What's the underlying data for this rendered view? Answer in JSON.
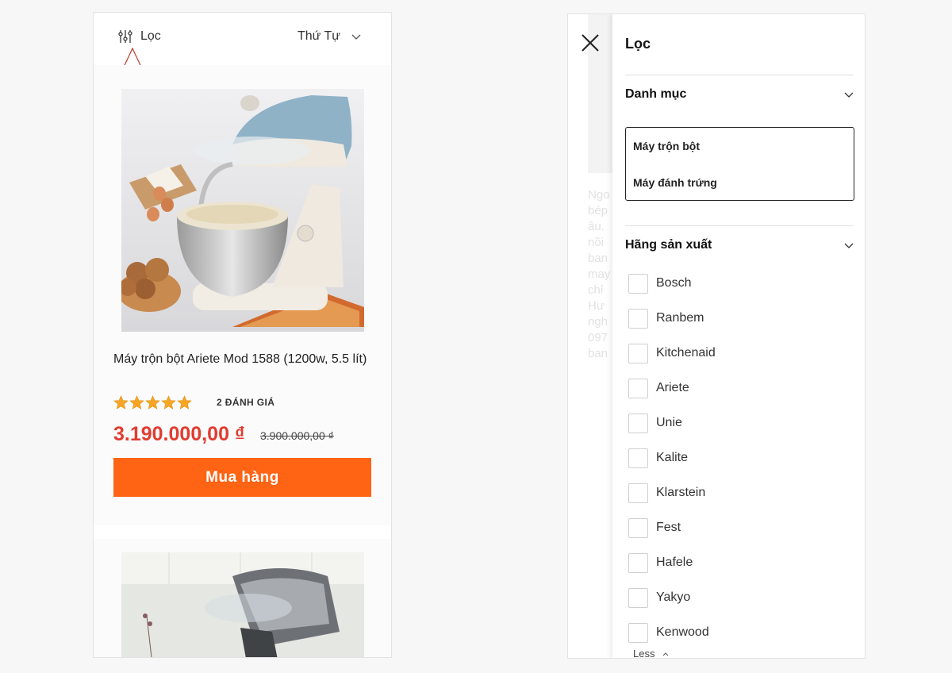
{
  "left": {
    "filter_label": "Lọc",
    "sort_label": "Thứ Tự",
    "product": {
      "title": "Máy trộn bột Ariete Mod 1588 (1200w, 5.5 lít)",
      "rating": 5,
      "reviews": "2 ĐÁNH GIÁ",
      "price": "3.190.000,00 ₫",
      "old_price": "3.900.000,00 ₫",
      "buy_label": "Mua hàng"
    }
  },
  "right": {
    "background_text": [
      "Ngo",
      "bép",
      "âu.",
      "nồi",
      "ban",
      "may",
      "chỉ",
      "Hư",
      "ngh",
      "097",
      "ban"
    ],
    "drawer": {
      "title": "Lọc",
      "category_heading": "Danh mục",
      "categories": [
        "Máy trộn bột",
        "Máy đánh trứng"
      ],
      "brand_heading": "Hãng sản xuất",
      "brands": [
        "Bosch",
        "Ranbem",
        "Kitchenaid",
        "Ariete",
        "Unie",
        "Kalite",
        "Klarstein",
        "Fest",
        "Hafele",
        "Yakyo",
        "Kenwood"
      ],
      "less_label": "Less"
    }
  },
  "colors": {
    "accent": "#ff6314",
    "price": "#e33b2f",
    "star": "#f6a623",
    "annotation": "#c0392b"
  }
}
